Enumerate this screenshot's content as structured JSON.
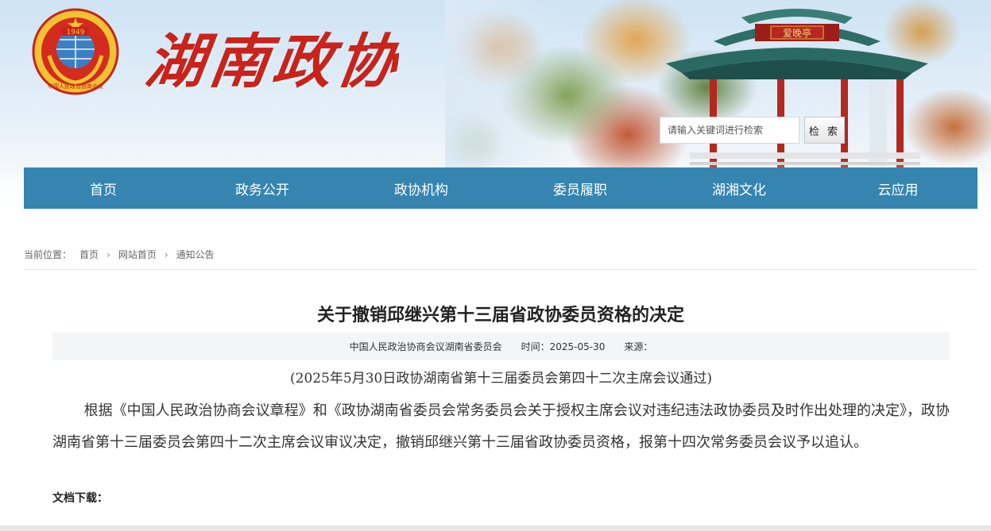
{
  "header": {
    "brand_text": "湖南政协",
    "emblem_caption": "中国人民政治协商会议",
    "emblem_year": "1949",
    "plaque_text": "爱晚亭"
  },
  "search": {
    "placeholder": "请输入关键词进行检索",
    "button_label": "检 索"
  },
  "nav": {
    "items": [
      "首页",
      "政务公开",
      "政协机构",
      "委员履职",
      "湖湘文化",
      "云应用"
    ]
  },
  "breadcrumb": {
    "label": "当前位置：",
    "items": [
      "首页",
      "网站首页",
      "通知公告"
    ]
  },
  "article": {
    "title": "关于撤销邱继兴第十三届省政协委员资格的决定",
    "meta_org": "中国人民政治协商会议湖南省委员会",
    "meta_time": "时间：2025-05-30",
    "meta_source": "来源：",
    "subtitle": "(2025年5月30日政协湖南省第十三届委员会第四十二次主席会议通过)",
    "body": "根据《中国人民政治协商会议章程》和《政协湖南省委员会常务委员会关于授权主席会议对违纪违法政协委员及时作出处理的决定》，政协湖南省第十三届委员会第四十二次主席会议审议决定，撤销邱继兴第十三届省政协委员资格，报第十四次常务委员会议予以追认。",
    "download_label": "文档下载："
  },
  "colors": {
    "nav_bg": "#3585b0",
    "brand_red": "#c9231b",
    "emblem_gold": "#f1c232",
    "meta_bg": "#f4f5f7"
  }
}
